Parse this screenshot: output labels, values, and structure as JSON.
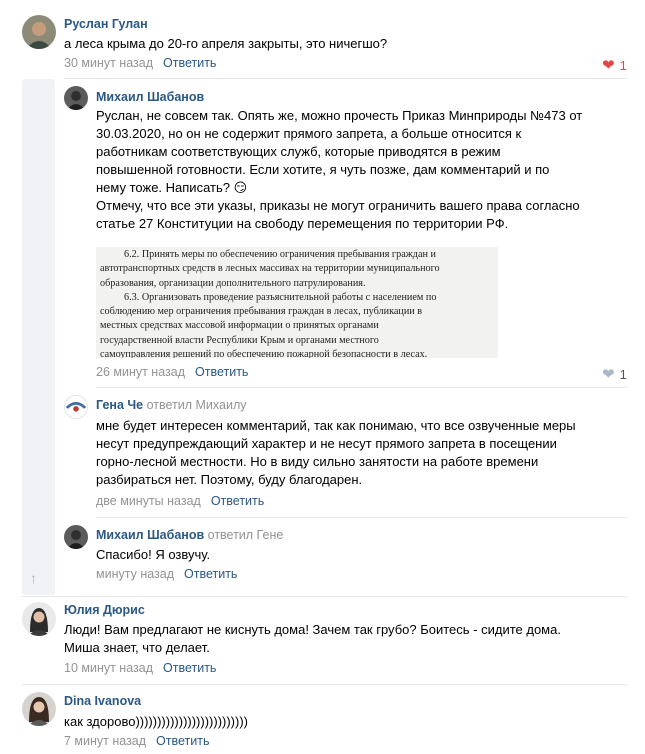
{
  "comments": [
    {
      "author": "Руслан Гулан",
      "text": "а леса крыма до 20-го апреля закрыты, это ничегшо?",
      "time": "30 минут назад",
      "reply_label": "Ответить",
      "likes": "1"
    },
    {
      "author": "Михаил Шабанов",
      "lines": [
        "Руслан, не совсем так. Опять же, можно прочесть Приказ Минприроды №473 от",
        "30.03.2020, но он не содержит прямого запрета, а больше относится к",
        "работникам соответствующих служб, которые приводятся в режим",
        "повышенной готовности. Если хотите, я чуть позже, дам комментарий и по",
        "нему тоже. Написать? 😏",
        "Отмечу, что все эти указы, приказы не могут ограничить вашего права согласно",
        "статье 27 Конституции на свободу перемещения по территории РФ."
      ],
      "image_lines": [
        "6.2.   Принять меры по обеспечению ограничения пребывания граждан и",
        "автотранспортных средств в лесных массивах на территории муниципального",
        "образования, организации дополнительного патрулирования.",
        "6.3.   Организовать проведение разъяснительной работы с населением по",
        "соблюдению мер ограничения пребывания граждан в лесах, публикации в",
        "местных средствах массовой информации о принятых органами",
        "государственной власти Республики Крым и органами местного",
        "самоуправления решений по обеспечению пожарной безопасности в лесах."
      ],
      "time": "26 минут назад",
      "reply_label": "Ответить",
      "likes": "1"
    },
    {
      "author": "Гена Че",
      "replied_to": "ответил Михаилу",
      "lines": [
        "мне будет интересен комментарий, так как понимаю, что все озвученные меры",
        "несут предупреждающий характер и не несут прямого запрета в посещении",
        "горно-лесной местности. Но в виду сильно занятости на работе времени",
        "разбираться нет. Поэтому, буду благодарен."
      ],
      "time": "две минуты назад",
      "reply_label": "Ответить"
    },
    {
      "author": "Михаил Шабанов",
      "replied_to": "ответил Гене",
      "text": "Спасибо! Я озвучу.",
      "time": "минуту назад",
      "reply_label": "Ответить"
    },
    {
      "author": "Юлия Дюрис",
      "lines": [
        "Люди! Вам предлагают не киснуть дома! Зачем так грубо? Боитесь - сидите дома.",
        "Миша знает, что делает."
      ],
      "time": "10 минут назад",
      "reply_label": "Ответить"
    },
    {
      "author": "Dina Ivanova",
      "text": "как здорово))))))))))))))))))))))))))",
      "time": "7 минут назад",
      "reply_label": "Ответить"
    }
  ],
  "icons": {
    "like_active": "heart-icon-red",
    "like_inactive": "heart-icon-grey",
    "collapse": "arrow-up-icon"
  },
  "colors": {
    "link": "#2a5885",
    "meta": "#939393",
    "like_active": "#e64646",
    "like_inactive": "#aab7c6",
    "thread_bar": "#f0f2f5"
  }
}
